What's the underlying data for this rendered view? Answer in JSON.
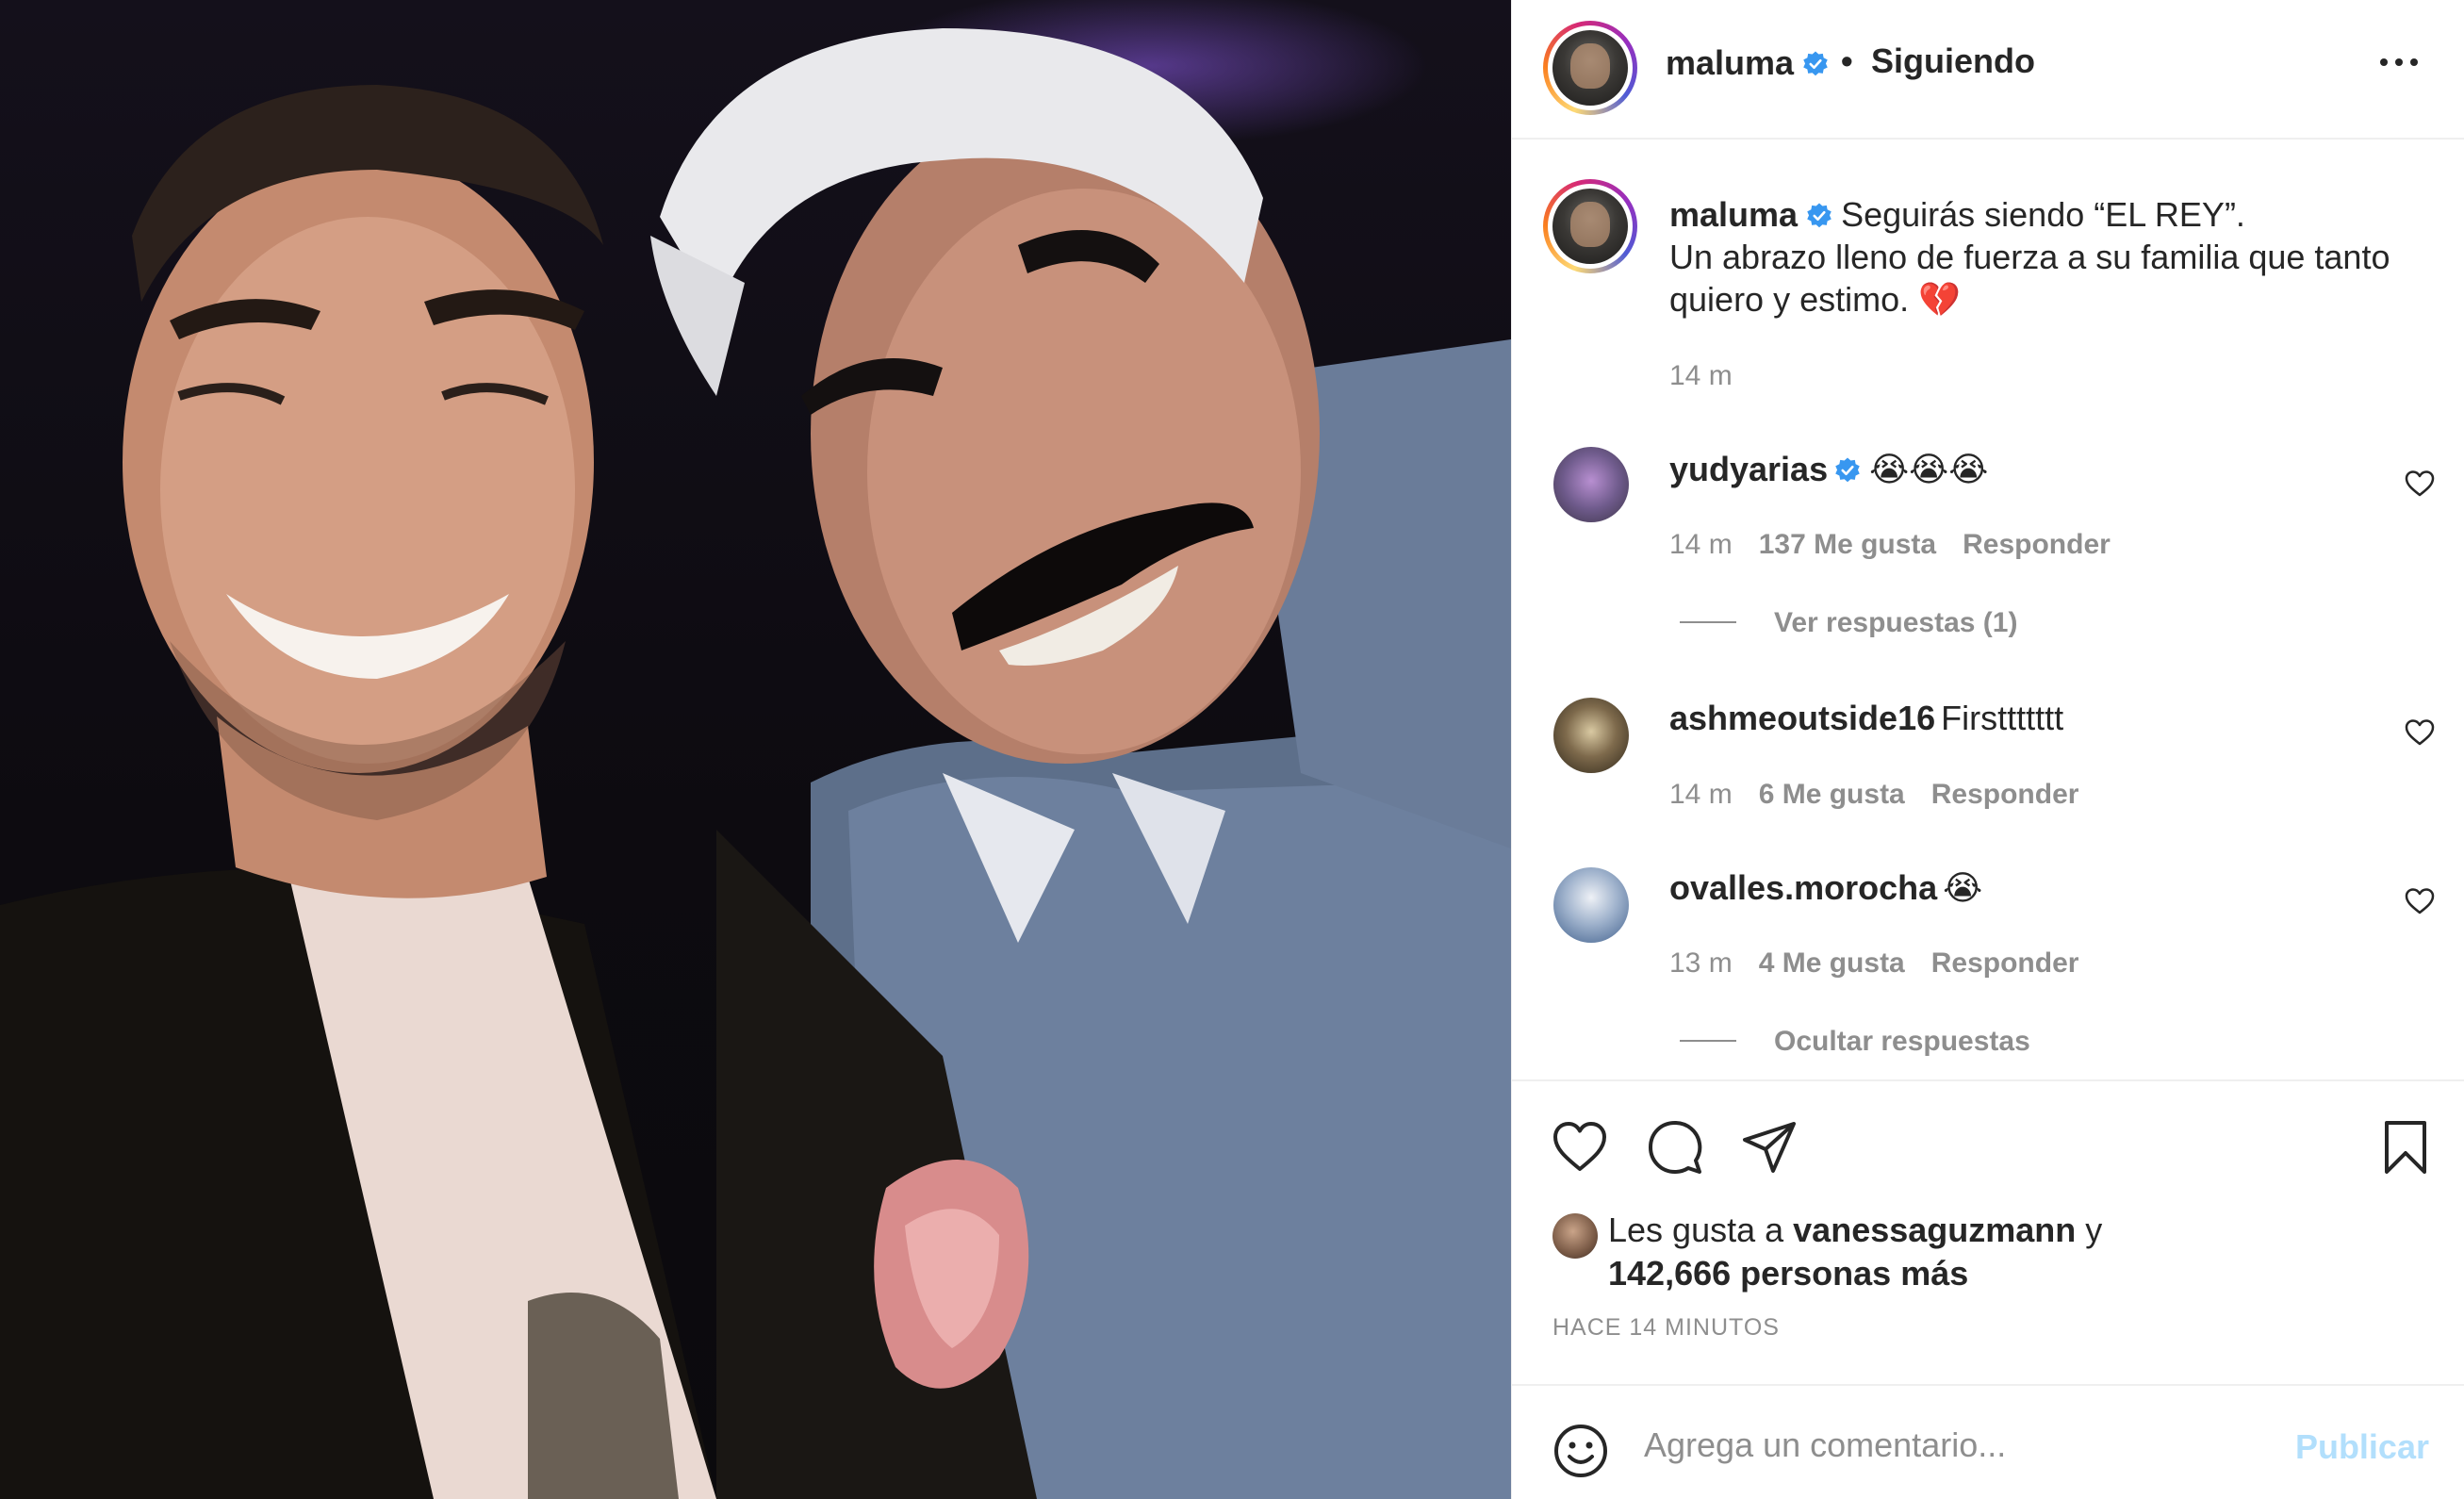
{
  "post": {
    "image_alt": "Selfie de maluma con un hombre de bigote",
    "username": "maluma",
    "separator": "•",
    "follow_status": "Siguiendo"
  },
  "caption": {
    "username": "maluma",
    "line1": "Seguirás siendo “EL REY”.",
    "line2": "Un abrazo lleno de fuerza a su familia que tanto quiero y estimo. 💔",
    "time": "14 m"
  },
  "comments": [
    {
      "username": "yudyarias",
      "verified": true,
      "text": "😭😭😭",
      "time": "14 m",
      "likes": "137 Me gusta",
      "reply": "Responder",
      "replies_toggle": "Ver respuestas (1)"
    },
    {
      "username": "ashmeoutside16",
      "verified": false,
      "text": "Firsttttttt",
      "time": "14 m",
      "likes": "6 Me gusta",
      "reply": "Responder"
    },
    {
      "username": "ovalles.morocha",
      "verified": false,
      "text": "😭",
      "time": "13 m",
      "likes": "4 Me gusta",
      "reply": "Responder",
      "replies_toggle": "Ocultar respuestas"
    }
  ],
  "likes": {
    "prefix": "Les gusta a",
    "user": "vanessaguzmann",
    "conj": "y",
    "count": "142,666 personas más"
  },
  "posted_ago": "HACE 14 MINUTOS",
  "comment_box": {
    "placeholder": "Agrega un comentario...",
    "publish": "Publicar"
  },
  "colors": {
    "verified": "#3897f0",
    "publish_disabled": "#b2dffc",
    "secondary_text": "#8e8e8e",
    "primary_text": "#262626"
  },
  "icons": [
    "more-options-icon",
    "verified-badge-icon",
    "heart-icon",
    "comment-icon",
    "share-icon",
    "save-icon",
    "emoji-icon"
  ]
}
